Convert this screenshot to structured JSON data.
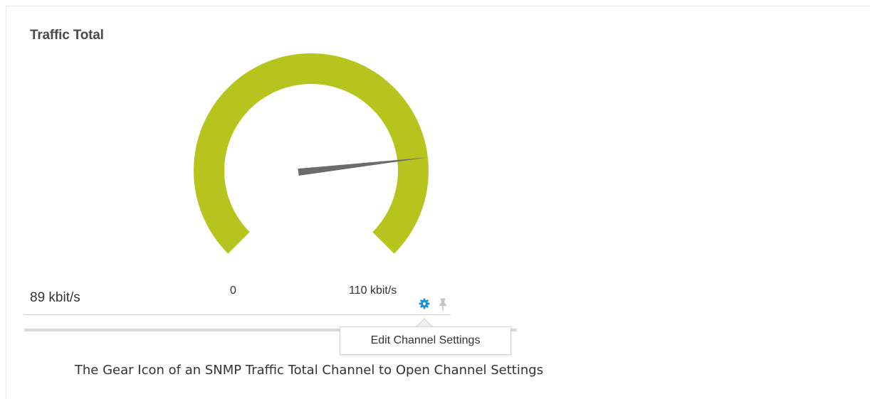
{
  "gauge": {
    "title": "Traffic Total",
    "current_value": "89 kbit/s",
    "min_label": "0",
    "max_label": "110 kbit/s",
    "value": 89,
    "max": 110,
    "arc_color": "#b8c41e",
    "needle_color": "#6b6b6b"
  },
  "tools": {
    "gear_icon": "gear-icon",
    "gear_color": "#1e8fd6",
    "pin_icon": "pin-icon",
    "pin_color": "#c4c4c4"
  },
  "tooltip": {
    "text": "Edit Channel Settings"
  },
  "caption": {
    "text": "The Gear Icon of an SNMP Traffic Total Channel to Open Channel Settings"
  }
}
